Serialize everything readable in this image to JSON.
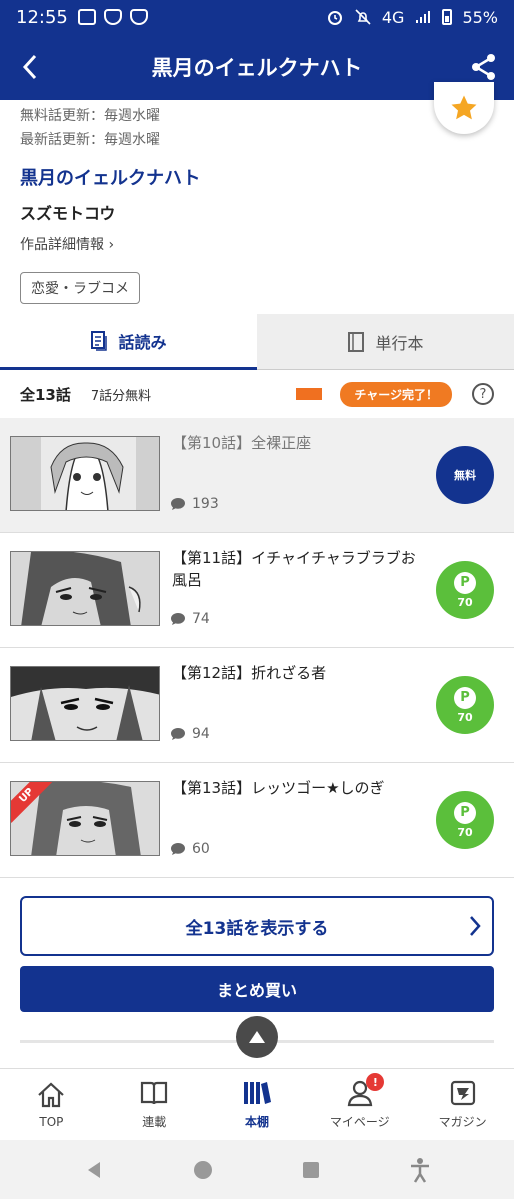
{
  "status_bar": {
    "time": "12:55",
    "network": "4G",
    "battery": "55%"
  },
  "app_bar": {
    "title": "黒月のイェルクナハト"
  },
  "work_info": {
    "free_update": "無料話更新：毎週水曜",
    "latest_update": "最新話更新：毎週水曜",
    "title": "黒月のイェルクナハト",
    "author": "スズモトコウ",
    "detail_link": "作品詳細情報",
    "genre": "恋愛・ラブコメ"
  },
  "tabs": [
    {
      "label": "話読み",
      "active": true
    },
    {
      "label": "単行本",
      "active": false
    }
  ],
  "list_header": {
    "total": "全13話",
    "free_count": "7話分無料",
    "charge_label": "チャージ完了！",
    "help": "?"
  },
  "episodes": [
    {
      "title": "【第10話】全裸正座",
      "comments": "193",
      "price_label": "無料",
      "free": true,
      "up": false
    },
    {
      "title": "【第11話】イチャイチャラブラブお風呂",
      "comments": "74",
      "price_label": "70",
      "free": false,
      "up": false
    },
    {
      "title": "【第12話】折れざる者",
      "comments": "94",
      "price_label": "70",
      "free": false,
      "up": false
    },
    {
      "title": "【第13話】レッツゴー★しのぎ",
      "comments": "60",
      "price_label": "70",
      "free": false,
      "up": true,
      "up_label": "UP"
    }
  ],
  "coin_letter": "P",
  "show_all_label": "全13話を表示する",
  "bulk_buy_label": "まとめ買い",
  "bottom_nav": [
    {
      "label": "TOP",
      "icon": "home-icon"
    },
    {
      "label": "連載",
      "icon": "book-icon"
    },
    {
      "label": "本棚",
      "icon": "bookshelf-icon",
      "active": true
    },
    {
      "label": "マイページ",
      "icon": "person-icon",
      "badge": "!"
    },
    {
      "label": "マガジン",
      "icon": "magazine-icon"
    }
  ],
  "colors": {
    "brand": "#13338f",
    "accent_orange": "#f07a22",
    "coin_green": "#5bbf3b",
    "up_red": "#e53935"
  }
}
